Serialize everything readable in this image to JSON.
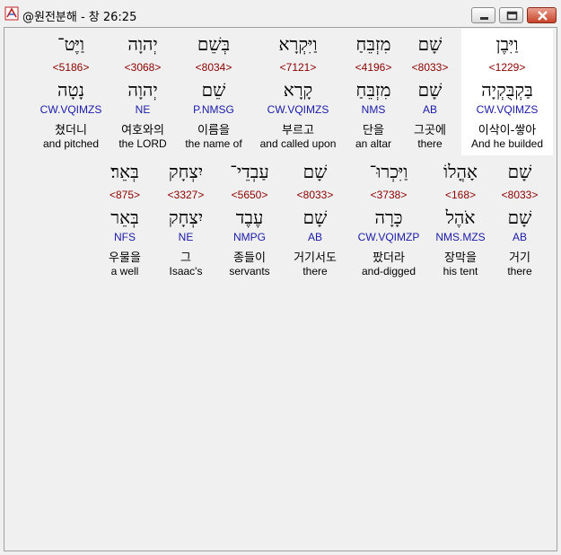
{
  "window": {
    "title": "@원전분해 - 창 26:25",
    "icons": {
      "app": "app-logo-icon",
      "minimize": "minimize-icon",
      "maximize": "maximize-icon",
      "close": "close-icon"
    }
  },
  "rows": [
    {
      "words": [
        {
          "heb": "וַיִּבֶן",
          "strong": "<1229>",
          "root": "בַּקְבֻּקְיָה",
          "morph": "CW.VQIMZS",
          "kor": "이삭이-쌓아",
          "eng": "And he builded"
        },
        {
          "heb": "שָׁם",
          "strong": "<8033>",
          "root": "שָׁם",
          "morph": "AB",
          "kor": "그곳에",
          "eng": "there"
        },
        {
          "heb": "מִזְבֵּחַ",
          "strong": "<4196>",
          "root": "מִזְבֵּחַ",
          "morph": "NMS",
          "kor": "단을",
          "eng": "an altar"
        },
        {
          "heb": "וַיִּקְרָא",
          "strong": "<7121>",
          "root": "קָרָא",
          "morph": "CW.VQIMZS",
          "kor": "부르고",
          "eng": "and called upon"
        },
        {
          "heb": "בְּשֵׁם",
          "strong": "<8034>",
          "root": "שֵׁם",
          "morph": "P.NMSG",
          "kor": "이름을",
          "eng": "the name of"
        },
        {
          "heb": "יְהוָה",
          "strong": "<3068>",
          "root": "יְהוָה",
          "morph": "NE",
          "kor": "여호와의",
          "eng": "the LORD"
        },
        {
          "heb": "וַיֶּט־",
          "strong": "<5186>",
          "root": "נָטָה",
          "morph": "CW.VQIMZS",
          "kor": "쳤더니",
          "eng": "and pitched"
        }
      ]
    },
    {
      "words": [
        {
          "heb": "שָׁם",
          "strong": "<8033>",
          "root": "שָׁם",
          "morph": "AB",
          "kor": "거기",
          "eng": "there"
        },
        {
          "heb": "אָהֳלוֹ",
          "strong": "<168>",
          "root": "אֹהֶל",
          "morph": "NMS.MZS",
          "kor": "장막을",
          "eng": "his tent"
        },
        {
          "heb": "וַיִּכְרוּ־",
          "strong": "<3738>",
          "root": "כָּרָה",
          "morph": "CW.VQIMZP",
          "kor": "팠더라",
          "eng": "and-digged"
        },
        {
          "heb": "שָׁם",
          "strong": "<8033>",
          "root": "שָׁם",
          "morph": "AB",
          "kor": "거기서도",
          "eng": "there"
        },
        {
          "heb": "עַבְדֵי־",
          "strong": "<5650>",
          "root": "עֶבֶד",
          "morph": "NMPG",
          "kor": "종들이",
          "eng": "servants"
        },
        {
          "heb": "יִצְחָק",
          "strong": "<3327>",
          "root": "יִצְחָק",
          "morph": "NE",
          "kor": "그",
          "eng": "Isaac's"
        },
        {
          "heb": "בְּאֵר׃",
          "strong": "<875>",
          "root": "בְּאֵר",
          "morph": "NFS",
          "kor": "우물을",
          "eng": "a well"
        }
      ]
    }
  ]
}
